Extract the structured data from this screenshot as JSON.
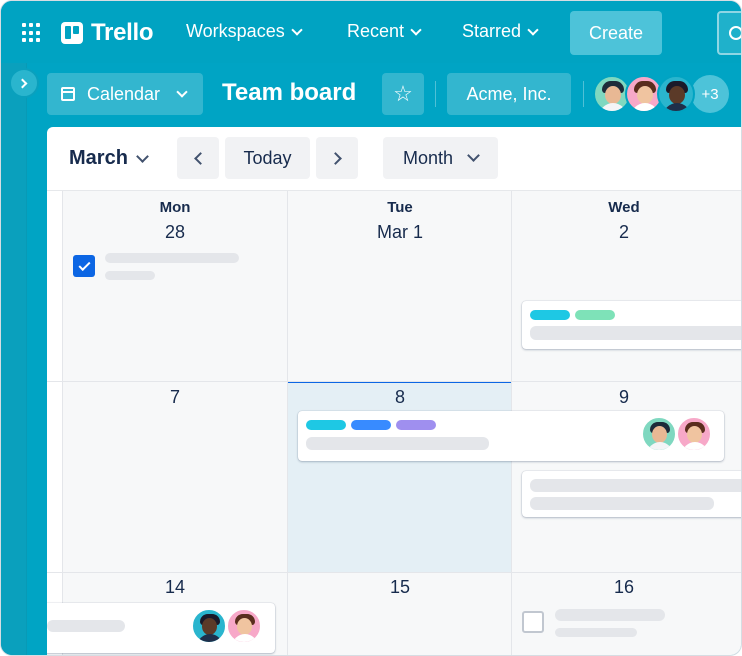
{
  "topnav": {
    "logo": "Trello",
    "items": [
      {
        "label": "Workspaces"
      },
      {
        "label": "Recent"
      },
      {
        "label": "Starred"
      }
    ],
    "create_label": "Create"
  },
  "board": {
    "view_label": "Calendar",
    "title": "Team board",
    "workspace": "Acme, Inc.",
    "member_more": "+3"
  },
  "calendar": {
    "month": "March",
    "today_label": "Today",
    "view_mode": "Month",
    "daynames": [
      "Mon",
      "Tue",
      "Wed"
    ],
    "week1": [
      "28",
      "Mar 1",
      "2"
    ],
    "week2": [
      "7",
      "8",
      "9"
    ],
    "week3": [
      "14",
      "15",
      "16"
    ]
  },
  "colors": {
    "brand": "#00a3c2",
    "label_cyan": "#1ec8e4",
    "label_green": "#7ee2b8",
    "label_blue": "#388bff",
    "label_purple": "#9f8fef",
    "check_blue": "#0c66e4"
  }
}
